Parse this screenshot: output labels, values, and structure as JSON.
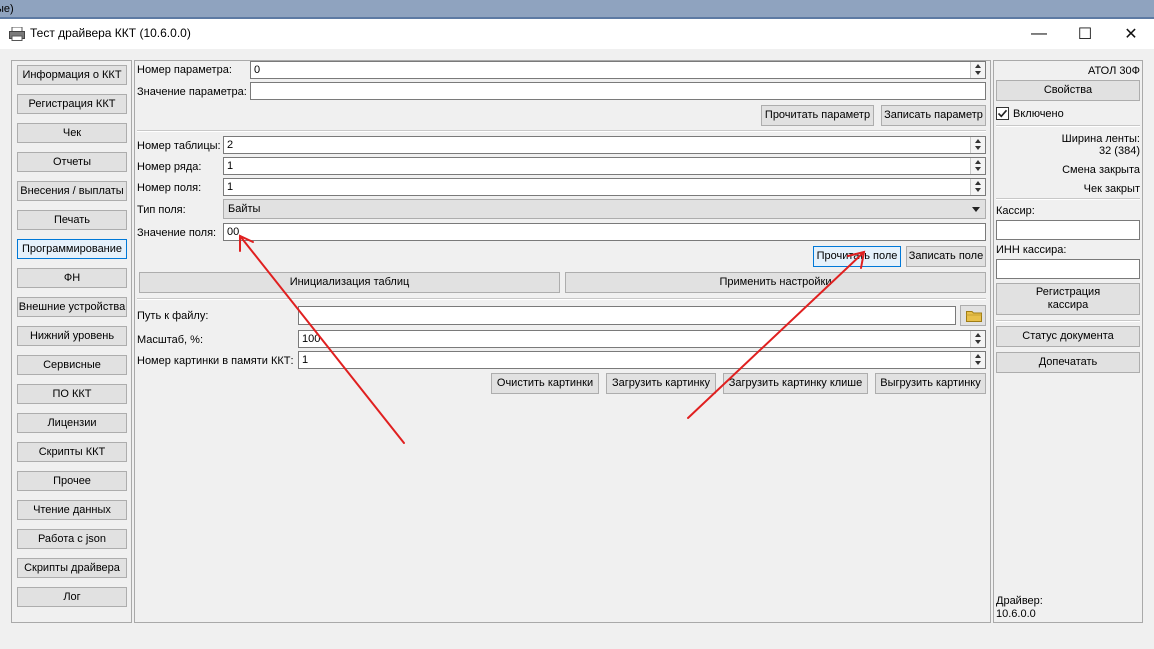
{
  "background_hint": "ые)",
  "window": {
    "title": "Тест драйвера ККТ (10.6.0.0)",
    "minimize": "—",
    "maximize": "☐",
    "close": "✕"
  },
  "sidebar": {
    "items": [
      {
        "label": "Информация о ККТ"
      },
      {
        "label": "Регистрация ККТ"
      },
      {
        "label": "Чек"
      },
      {
        "label": "Отчеты"
      },
      {
        "label": "Внесения / выплаты"
      },
      {
        "label": "Печать"
      },
      {
        "label": "Программирование",
        "active": true
      },
      {
        "label": "ФН"
      },
      {
        "label": "Внешние устройства"
      },
      {
        "label": "Нижний уровень"
      },
      {
        "label": "Сервисные"
      },
      {
        "label": "ПО ККТ"
      },
      {
        "label": "Лицензии"
      },
      {
        "label": "Скрипты ККТ"
      },
      {
        "label": "Прочее"
      },
      {
        "label": "Чтение данных"
      },
      {
        "label": "Работа с json"
      },
      {
        "label": "Скрипты драйвера"
      },
      {
        "label": "Лог"
      }
    ]
  },
  "main": {
    "param_number_label": "Номер параметра:",
    "param_number_value": "0",
    "param_value_label": "Значение параметра:",
    "param_value_value": "",
    "read_param": "Прочитать параметр",
    "write_param": "Записать параметр",
    "table_number_label": "Номер таблицы:",
    "table_number_value": "2",
    "row_number_label": "Номер ряда:",
    "row_number_value": "1",
    "field_number_label": "Номер поля:",
    "field_number_value": "1",
    "field_type_label": "Тип поля:",
    "field_type_value": "Байты",
    "field_value_label": "Значение поля:",
    "field_value_value": "00",
    "read_field": "Прочитать поле",
    "write_field": "Записать поле",
    "init_tables": "Инициализация таблиц",
    "apply_settings": "Применить настройки",
    "file_path_label": "Путь к файлу:",
    "file_path_value": "",
    "scale_label": "Масштаб, %:",
    "scale_value": "100",
    "picture_number_label": "Номер картинки в памяти ККТ:",
    "picture_number_value": "1",
    "clear_pictures": "Очистить картинки",
    "load_picture": "Загрузить картинку",
    "load_cliche_picture": "Загрузить картинку клише",
    "unload_picture": "Выгрузить картинку"
  },
  "right": {
    "device_name": "АТОЛ 30Ф",
    "properties": "Свойства",
    "enabled_label": "Включено",
    "enabled_checked": true,
    "tape_width_label": "Ширина ленты:",
    "tape_width_value": "32 (384)",
    "shift_status": "Смена закрыта",
    "receipt_status": "Чек закрыт",
    "cashier_label": "Кассир:",
    "cashier_value": "",
    "cashier_inn_label": "ИНН кассира:",
    "cashier_inn_value": "",
    "register_cashier_line1": "Регистрация",
    "register_cashier_line2": "кассира",
    "document_status": "Статус документа",
    "reprint": "Допечатать",
    "driver_label": "Драйвер:",
    "driver_version": "10.6.0.0"
  },
  "colors": {
    "annotation_arrow": "#e02020",
    "active_accent": "#0078d7"
  }
}
